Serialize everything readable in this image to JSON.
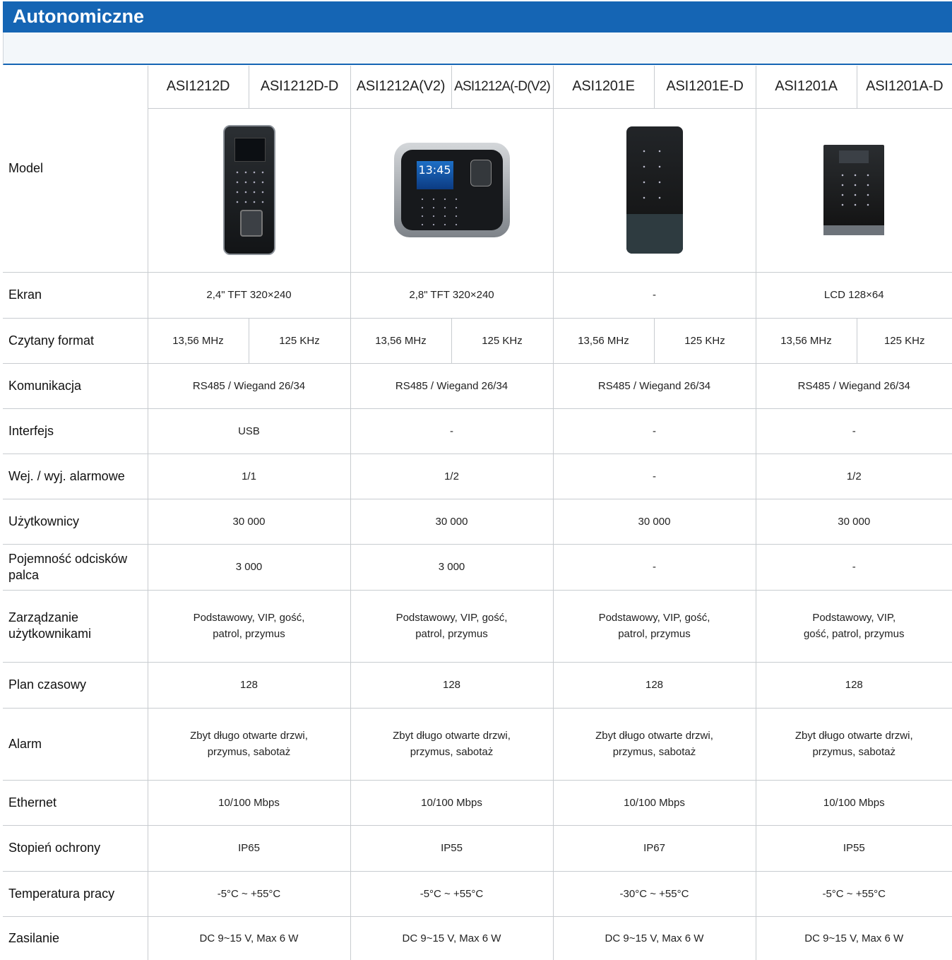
{
  "header": {
    "title": "Autonomiczne"
  },
  "models": {
    "label": "Model",
    "names": [
      "ASI1212D",
      "ASI1212D-D",
      "ASI1212A(V2)",
      "ASI1212A(-D(V2)",
      "ASI1201E",
      "ASI1201E-D",
      "ASI1201A",
      "ASI1201A-D"
    ],
    "groups": [
      {
        "image_icon": "fingerprint-keypad-reader-icon"
      },
      {
        "image_icon": "fingerprint-terminal-screen-icon",
        "screen_time": "13:45"
      },
      {
        "image_icon": "touch-keypad-reader-icon"
      },
      {
        "image_icon": "lcd-keypad-reader-icon"
      }
    ]
  },
  "rows": {
    "ekran": {
      "label": "Ekran",
      "values": [
        "2,4\" TFT 320×240",
        "2,8\" TFT 320×240",
        "-",
        "LCD 128×64"
      ]
    },
    "format": {
      "label": "Czytany format",
      "values": [
        "13,56 MHz",
        "125 KHz",
        "13,56 MHz",
        "125 KHz",
        "13,56 MHz",
        "125 KHz",
        "13,56 MHz",
        "125 KHz"
      ]
    },
    "komunikacja": {
      "label": "Komunikacja",
      "values": [
        "RS485 / Wiegand 26/34",
        "RS485 / Wiegand 26/34",
        "RS485 / Wiegand 26/34",
        "RS485 / Wiegand 26/34"
      ]
    },
    "interfejs": {
      "label": "Interfejs",
      "values": [
        "USB",
        "-",
        "-",
        "-"
      ]
    },
    "alarmowe": {
      "label": "Wej. / wyj. alarmowe",
      "values": [
        "1/1",
        "1/2",
        "-",
        "1/2"
      ]
    },
    "uzytkownicy": {
      "label": "Użytkownicy",
      "values": [
        "30 000",
        "30 000",
        "30 000",
        "30 000"
      ]
    },
    "odciski": {
      "label": "Pojemność odcisków palca",
      "values": [
        "3 000",
        "3 000",
        "-",
        "-"
      ]
    },
    "zarzadzanie": {
      "label": "Zarządzanie użytkownikami",
      "values": [
        "Podstawowy, VIP, gość, patrol, przymus",
        "Podstawowy, VIP, gość, patrol, przymus",
        "Podstawowy, VIP, gość, patrol, przymus",
        "Podstawowy, VIP, gość, patrol, przymus"
      ]
    },
    "plan": {
      "label": "Plan czasowy",
      "values": [
        "128",
        "128",
        "128",
        "128"
      ]
    },
    "alarm": {
      "label": "Alarm",
      "values": [
        "Zbyt długo otwarte drzwi, przymus, sabotaż",
        "Zbyt długo otwarte drzwi, przymus, sabotaż",
        "Zbyt długo otwarte drzwi, przymus, sabotaż",
        "Zbyt długo otwarte drzwi, przymus, sabotaż"
      ]
    },
    "ethernet": {
      "label": "Ethernet",
      "values": [
        "10/100 Mbps",
        "10/100 Mbps",
        "10/100 Mbps",
        "10/100 Mbps"
      ]
    },
    "ochrona": {
      "label": "Stopień ochrony",
      "values": [
        "IP65",
        "IP55",
        "IP67",
        "IP55"
      ]
    },
    "temperatura": {
      "label": "Temperatura pracy",
      "values": [
        "-5°C ~ +55°C",
        "-5°C ~ +55°C",
        "-30°C ~ +55°C",
        "-5°C ~ +55°C"
      ]
    },
    "zasilanie": {
      "label": "Zasilanie",
      "values": [
        "DC 9~15 V, Max 6 W",
        "DC 9~15 V, Max 6 W",
        "DC 9~15 V, Max 6 W",
        "DC 9~15 V, Max 6 W"
      ]
    }
  },
  "colors": {
    "header_bg": "#1565b4",
    "subheader_bg": "#f3f7fa",
    "grid": "#c8ccd0"
  }
}
